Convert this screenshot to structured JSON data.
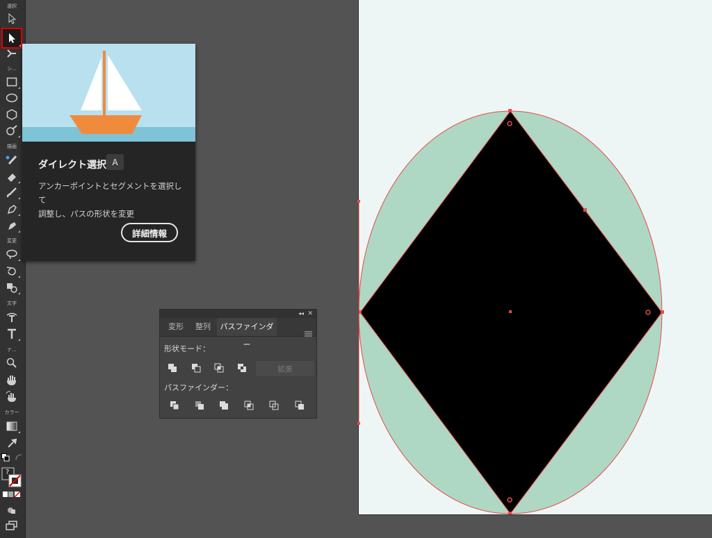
{
  "toolbar": {
    "labels": {
      "select": "選択",
      "shape": "シ...",
      "draw": "描画",
      "modify": "変更",
      "type": "文字",
      "navigate": "ナ...",
      "color": "カラー"
    },
    "tools": [
      "selection-tool-icon",
      "direct-selection-tool-icon",
      "magic-wand-icon",
      "rectangle-tool-icon",
      "ellipse-tool-icon",
      "polygon-tool-icon",
      "shaper-tool-icon",
      "pencil-tool-icon",
      "eraser-tool-icon",
      "paintbrush-tool-icon",
      "pen-tool-icon",
      "curvature-tool-icon",
      "lasso-tool-icon",
      "rotate-tool-icon",
      "scale-tool-icon",
      "type-on-path-icon",
      "type-tool-icon",
      "zoom-tool-icon",
      "hand-tool-icon",
      "rotate-view-icon",
      "gradient-tool-icon",
      "eyedropper-tool-icon",
      "default-colors-icon",
      "swap-colors-icon",
      "fill-stroke-icon",
      "color-modes-icon",
      "draw-modes-icon",
      "screen-mode-icon"
    ],
    "fill_stroke_question": "?",
    "highlight_color": "#e00000"
  },
  "tooltip": {
    "title": "ダイレクト選択",
    "shortcut": "A",
    "description_line1": "アンカーポイントとセグメントを選択して",
    "description_line2": "調整し、パスの形状を変更",
    "more_button": "詳細情報",
    "illustration": "sailboat-illustration"
  },
  "panel": {
    "collapse": "◂◂",
    "close": "✕",
    "tabs": [
      {
        "label": "変形",
        "active": false
      },
      {
        "label": "整列",
        "active": false
      },
      {
        "label": "パスファインダー",
        "active": true
      }
    ],
    "shape_modes_label": "形状モード：",
    "shape_mode_buttons": [
      "unite-icon",
      "minus-front-icon",
      "intersect-icon",
      "exclude-icon"
    ],
    "expand_button": "拡張",
    "pathfinders_label": "パスファインダー：",
    "pathfinder_buttons": [
      "divide-icon",
      "trim-icon",
      "merge-icon",
      "crop-icon",
      "outline-icon",
      "minus-back-icon"
    ]
  },
  "canvas": {
    "artboard_color": "#eef6f5",
    "ellipse_fill": "#aed8c3",
    "diamond_fill": "#000000",
    "selection_color": "#e8484c"
  }
}
